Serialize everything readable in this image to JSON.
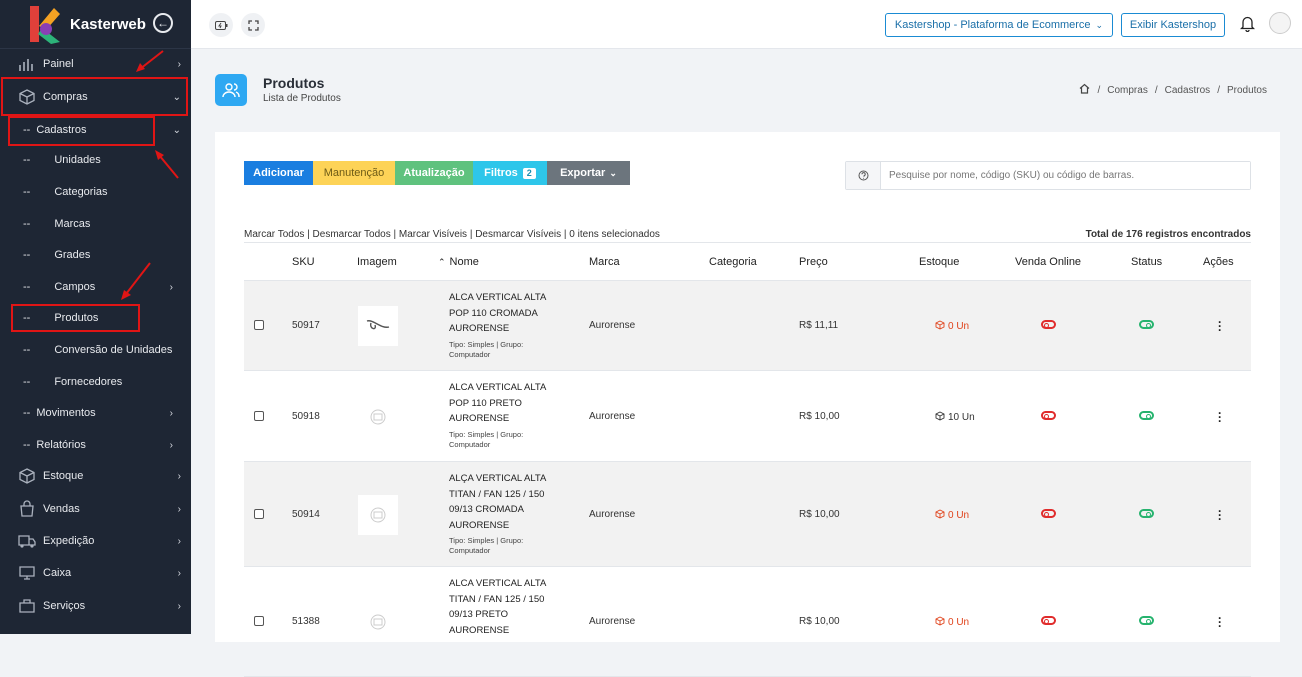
{
  "app": {
    "brand": "Kasterweb",
    "accent": "#1a8bd3",
    "sidebar_bg": "#1e2634"
  },
  "sidebar": {
    "painel": "Painel",
    "compras": "Compras",
    "cadastros": "Cadastros",
    "unidades": "Unidades",
    "categorias": "Categorias",
    "marcas": "Marcas",
    "grades": "Grades",
    "campos": "Campos",
    "produtos": "Produtos",
    "conversao": "Conversão de Unidades",
    "fornecedores": "Fornecedores",
    "movimentos": "Movimentos",
    "relatorios": "Relatórios",
    "estoque": "Estoque",
    "vendas": "Vendas",
    "expedicao": "Expedição",
    "caixa": "Caixa",
    "servicos": "Serviços",
    "dash": "--"
  },
  "topbar": {
    "store_select": "Kastershop - Plataforma de Ecommerce",
    "show_store": "Exibir Kastershop"
  },
  "header": {
    "title": "Produtos",
    "subtitle": "Lista de Produtos",
    "crumbs": [
      "Compras",
      "Cadastros",
      "Produtos"
    ],
    "crumb_sep": "/"
  },
  "toolbar": {
    "add": "Adicionar",
    "maintenance": "Manutenção",
    "update": "Atualização",
    "filters": "Filtros",
    "filters_count": "2",
    "export": "Exportar",
    "search_placeholder": "Pesquise por nome, código (SKU) ou código de barras."
  },
  "selection": {
    "links": "Marcar Todos | Desmarcar Todos | Marcar Visíveis | Desmarcar Visíveis | 0 itens selecionados",
    "total": "Total de 176 registros encontrados"
  },
  "table": {
    "columns": {
      "sku": "SKU",
      "image": "Imagem",
      "name": "Nome",
      "brand": "Marca",
      "category": "Categoria",
      "price": "Preço",
      "stock": "Estoque",
      "online": "Venda Online",
      "status": "Status",
      "actions": "Ações"
    },
    "rows": [
      {
        "sku": "50917",
        "name_lines": [
          "ALCA VERTICAL ALTA",
          "POP 110 CROMADA",
          "AURORENSE"
        ],
        "meta_lines": [
          "Tipo: Simples | Grupo:",
          "Computador"
        ],
        "brand": "Aurorense",
        "category": "",
        "price": "R$ 11,11",
        "stock": "0 Un",
        "stock_zero": true,
        "online": false,
        "status": true
      },
      {
        "sku": "50918",
        "name_lines": [
          "ALCA VERTICAL ALTA",
          "POP 110 PRETO",
          "AURORENSE"
        ],
        "meta_lines": [
          "Tipo: Simples | Grupo:",
          "Computador"
        ],
        "brand": "Aurorense",
        "category": "",
        "price": "R$ 10,00",
        "stock": "10 Un",
        "stock_zero": false,
        "online": false,
        "status": true
      },
      {
        "sku": "50914",
        "name_lines": [
          "ALÇA VERTICAL ALTA",
          "TITAN / FAN 125 / 150",
          "09/13 CROMADA",
          "AURORENSE"
        ],
        "meta_lines": [
          "Tipo: Simples | Grupo:",
          "Computador"
        ],
        "brand": "Aurorense",
        "category": "",
        "price": "R$ 10,00",
        "stock": "0 Un",
        "stock_zero": true,
        "online": false,
        "status": true
      },
      {
        "sku": "51388",
        "name_lines": [
          "ALCA VERTICAL ALTA",
          "TITAN / FAN 125 / 150",
          "09/13 PRETO",
          "AURORENSE"
        ],
        "meta_lines": [],
        "brand": "Aurorense",
        "category": "",
        "price": "R$ 10,00",
        "stock": "0 Un",
        "stock_zero": true,
        "online": false,
        "status": true
      }
    ]
  }
}
